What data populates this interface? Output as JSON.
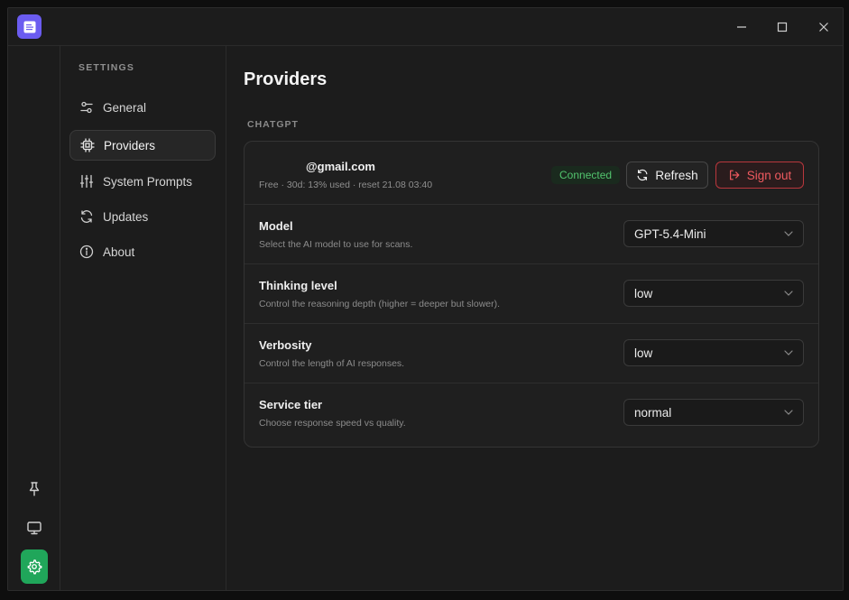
{
  "sidenav": {
    "heading": "SETTINGS",
    "items": [
      {
        "label": "General",
        "icon": "sliders-icon"
      },
      {
        "label": "Providers",
        "icon": "cpu-chip-icon"
      },
      {
        "label": "System Prompts",
        "icon": "equalizer-icon"
      },
      {
        "label": "Updates",
        "icon": "refresh-icon"
      },
      {
        "label": "About",
        "icon": "info-icon"
      }
    ],
    "active_index": 1
  },
  "main": {
    "title": "Providers",
    "section": "CHATGPT",
    "account": {
      "email": "@gmail.com",
      "usage": "Free · 30d: 13% used · reset 21.08 03:40",
      "status": "Connected",
      "refresh_label": "Refresh",
      "signout_label": "Sign out"
    },
    "settings": [
      {
        "title": "Model",
        "description": "Select the AI model to use for scans.",
        "value": "GPT-5.4-Mini"
      },
      {
        "title": "Thinking level",
        "description": "Control the reasoning depth (higher = deeper but slower).",
        "value": "low"
      },
      {
        "title": "Verbosity",
        "description": "Control the length of AI responses.",
        "value": "low"
      },
      {
        "title": "Service tier",
        "description": "Choose response speed vs quality.",
        "value": "normal"
      }
    ]
  },
  "colors": {
    "accent_logo": "#6b5cf0",
    "settings_active": "#20a65a",
    "connected": "#52c46e",
    "danger": "#ef5a5f"
  }
}
